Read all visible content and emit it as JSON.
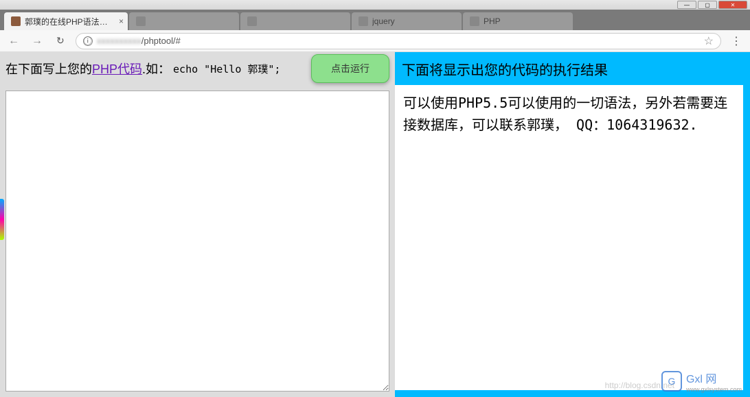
{
  "window": {
    "buttons": {
      "min": "—",
      "max": "▢",
      "close": "✕"
    }
  },
  "tabs": [
    {
      "title": "郭璞的在线PHP语法练习",
      "active": true
    },
    {
      "title": "",
      "active": false
    },
    {
      "title": "",
      "active": false
    },
    {
      "title": "jquery",
      "active": false
    },
    {
      "title": "PHP",
      "active": false
    }
  ],
  "addressbar": {
    "back": "←",
    "forward": "→",
    "reload": "↻",
    "info": "ⓘ",
    "url_hidden": "xxxxxxxxxx",
    "url_visible": "/phptool/#",
    "star": "☆",
    "menu": "⋮"
  },
  "left": {
    "header_prefix": "在下面写上您的",
    "header_link": "PHP代码",
    "header_suffix": ".如：",
    "header_example": "echo \"Hello 郭璞\";",
    "run_button": "点击运行",
    "code_value": ""
  },
  "right": {
    "header": "下面将显示出您的代码的执行结果",
    "result": "可以使用PHP5.5可以使用的一切语法，另外若需要连接数据库，可以联系郭璞，  QQ：1064319632."
  },
  "watermark": {
    "logo": "G",
    "text": "Gxl 网",
    "sub": "www.gxlsystem.com",
    "faded_url": "http://blog.csdn.net"
  }
}
